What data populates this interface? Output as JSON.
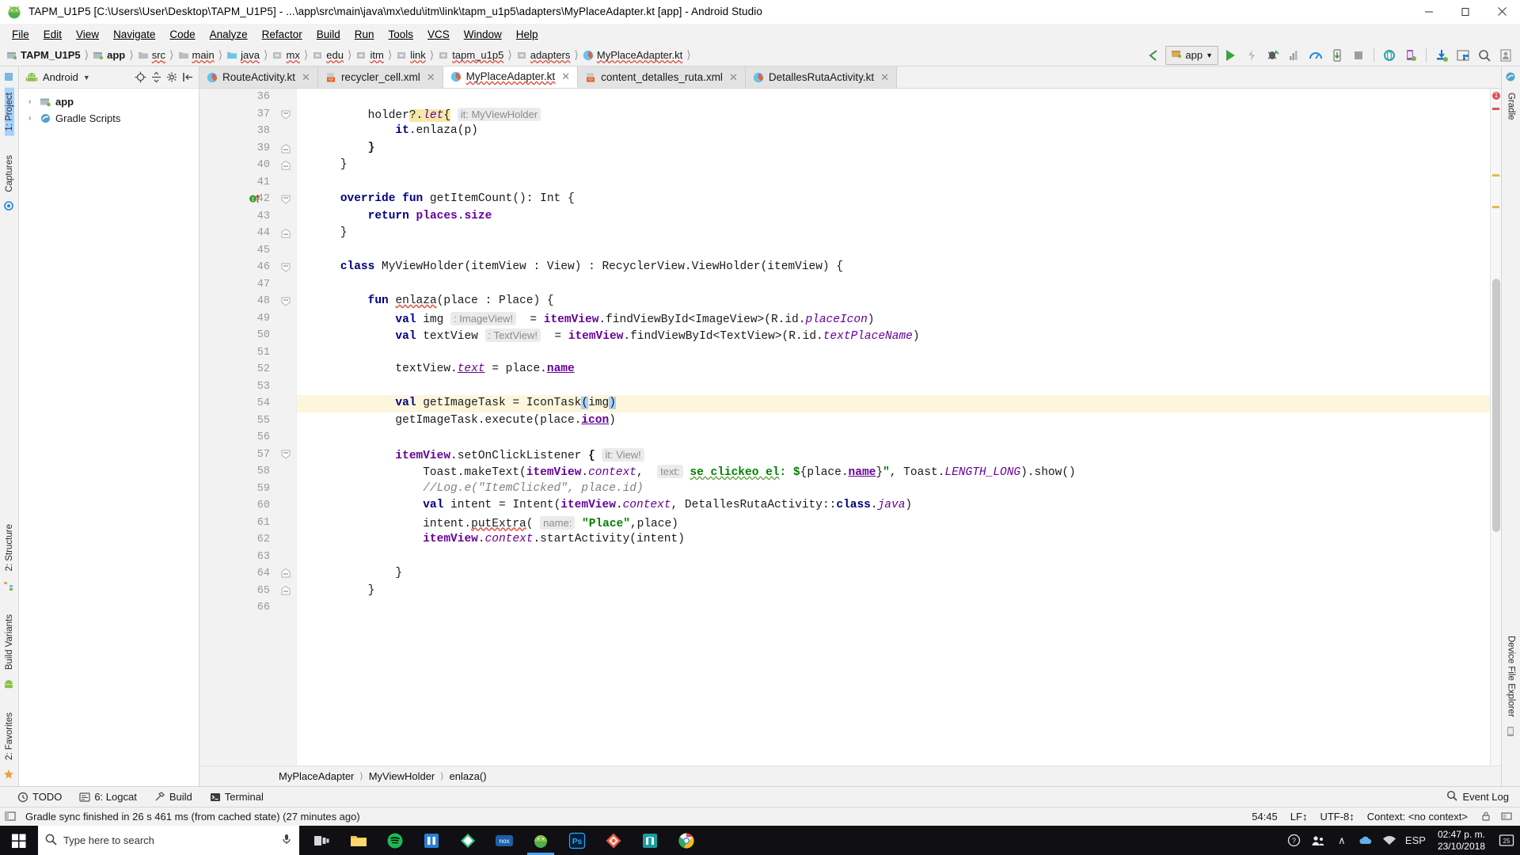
{
  "window": {
    "title": "TAPM_U1P5 [C:\\Users\\User\\Desktop\\TAPM_U1P5] - ...\\app\\src\\main\\java\\mx\\edu\\itm\\link\\tapm_u1p5\\adapters\\MyPlaceAdapter.kt [app] - Android Studio",
    "minimize": "─",
    "maximize": "❐",
    "close": "✕"
  },
  "menu": [
    {
      "label": "File"
    },
    {
      "label": "Edit"
    },
    {
      "label": "View"
    },
    {
      "label": "Navigate"
    },
    {
      "label": "Code"
    },
    {
      "label": "Analyze"
    },
    {
      "label": "Refactor"
    },
    {
      "label": "Build"
    },
    {
      "label": "Run"
    },
    {
      "label": "Tools"
    },
    {
      "label": "VCS"
    },
    {
      "label": "Window"
    },
    {
      "label": "Help"
    }
  ],
  "breadcrumbs": [
    {
      "label": "TAPM_U1P5",
      "icon": "module-icon",
      "bold": true,
      "error": false
    },
    {
      "label": "app",
      "icon": "module-icon",
      "bold": true,
      "error": false
    },
    {
      "label": "src",
      "icon": "folder-icon",
      "bold": false,
      "error": true
    },
    {
      "label": "main",
      "icon": "folder-icon",
      "bold": false,
      "error": true
    },
    {
      "label": "java",
      "icon": "folder-source-icon",
      "bold": false,
      "error": true
    },
    {
      "label": "mx",
      "icon": "package-icon",
      "bold": false,
      "error": true
    },
    {
      "label": "edu",
      "icon": "package-icon",
      "bold": false,
      "error": true
    },
    {
      "label": "itm",
      "icon": "package-icon",
      "bold": false,
      "error": true
    },
    {
      "label": "link",
      "icon": "package-icon",
      "bold": false,
      "error": true
    },
    {
      "label": "tapm_u1p5",
      "icon": "package-icon",
      "bold": false,
      "error": true
    },
    {
      "label": "adapters",
      "icon": "package-icon",
      "bold": false,
      "error": true
    },
    {
      "label": "MyPlaceAdapter.kt",
      "icon": "kotlin-icon",
      "bold": false,
      "error": true
    }
  ],
  "toolbar": {
    "back_arrow": "back-arrow-icon",
    "run_config_label": "app",
    "run_config_caret": "∨",
    "buttons": [
      "run-button",
      "apply-changes-button",
      "debug-button",
      "run-coverage-button",
      "profile-button",
      "attach-debugger-button",
      "stop-button",
      "sync-gradle-button",
      "avd-manager-button",
      "sdk-manager-button",
      "project-structure-button",
      "search-everywhere-button",
      "user-account-button"
    ]
  },
  "leftRail": {
    "items": [
      {
        "label": "1: Project",
        "name": "tool-project"
      },
      {
        "label": "Captures",
        "name": "tool-captures"
      },
      {
        "label": "2: Structure",
        "name": "tool-structure"
      },
      {
        "label": "Build Variants",
        "name": "tool-build-variants"
      },
      {
        "label": "2: Favorites",
        "name": "tool-favorites"
      }
    ]
  },
  "rightRail": {
    "items": [
      {
        "label": "Gradle",
        "name": "tool-gradle"
      },
      {
        "label": "Device File Explorer",
        "name": "tool-device-file-explorer"
      }
    ]
  },
  "project": {
    "header_title": "Android",
    "header_caret": "▾",
    "header_buttons": [
      "locate-icon",
      "collapse-all-icon",
      "settings-icon",
      "hide-icon"
    ],
    "tree": [
      {
        "label": "app",
        "arrow": "›",
        "icon": "module-icon",
        "bold": true
      },
      {
        "label": "Gradle Scripts",
        "arrow": "›",
        "icon": "gradle-icon",
        "bold": false
      }
    ]
  },
  "tabs": [
    {
      "label": "RouteActivity.kt",
      "icon": "kotlin-icon",
      "active": false,
      "error": false
    },
    {
      "label": "recycler_cell.xml",
      "icon": "xml-icon",
      "active": false,
      "error": false
    },
    {
      "label": "MyPlaceAdapter.kt",
      "icon": "kotlin-icon",
      "active": true,
      "error": true
    },
    {
      "label": "content_detalles_ruta.xml",
      "icon": "xml-icon",
      "active": false,
      "error": false
    },
    {
      "label": "DetallesRutaActivity.kt",
      "icon": "kotlin-icon",
      "active": false,
      "error": false
    }
  ],
  "editor": {
    "first_line": 36,
    "last_line": 66,
    "highlight_line": 54,
    "caret_position": "54:45",
    "lines": [
      {
        "n": 36,
        "text": ""
      },
      {
        "n": 37,
        "text": "        holder?.let{ it: MyViewHolder"
      },
      {
        "n": 38,
        "text": "            it.enlaza(p)"
      },
      {
        "n": 39,
        "text": "        }"
      },
      {
        "n": 40,
        "text": "    }"
      },
      {
        "n": 41,
        "text": ""
      },
      {
        "n": 42,
        "text": "    override fun getItemCount(): Int {"
      },
      {
        "n": 43,
        "text": "        return places.size"
      },
      {
        "n": 44,
        "text": "    }"
      },
      {
        "n": 45,
        "text": ""
      },
      {
        "n": 46,
        "text": "    class MyViewHolder(itemView : View) : RecyclerView.ViewHolder(itemView) {"
      },
      {
        "n": 47,
        "text": ""
      },
      {
        "n": 48,
        "text": "        fun enlaza(place : Place) {"
      },
      {
        "n": 49,
        "text": "            val img : ImageView!  = itemView.findViewById<ImageView>(R.id.placeIcon)"
      },
      {
        "n": 50,
        "text": "            val textView : TextView!  = itemView.findViewById<TextView>(R.id.textPlaceName)"
      },
      {
        "n": 51,
        "text": ""
      },
      {
        "n": 52,
        "text": "            textView.text = place.name"
      },
      {
        "n": 53,
        "text": ""
      },
      {
        "n": 54,
        "text": "            val getImageTask = IconTask(img)"
      },
      {
        "n": 55,
        "text": "            getImageTask.execute(place.icon)"
      },
      {
        "n": 56,
        "text": ""
      },
      {
        "n": 57,
        "text": "            itemView.setOnClickListener { it: View!"
      },
      {
        "n": 58,
        "text": "                Toast.makeText(itemView.context,  text: \"se clickeo el: ${place.name}\", Toast.LENGTH_LONG).show()"
      },
      {
        "n": 59,
        "text": "                //Log.e(\"ItemClicked\", place.id)"
      },
      {
        "n": 60,
        "text": "                val intent = Intent(itemView.context, DetallesRutaActivity::class.java)"
      },
      {
        "n": 61,
        "text": "                intent.putExtra( name: \"Place\",place)"
      },
      {
        "n": 62,
        "text": "                itemView.context.startActivity(intent)"
      },
      {
        "n": 63,
        "text": ""
      },
      {
        "n": 64,
        "text": "            }"
      },
      {
        "n": 65,
        "text": "        }"
      },
      {
        "n": 66,
        "text": ""
      }
    ],
    "inlay_hints": [
      "it: MyViewHolder",
      ": ImageView!",
      ": TextView!",
      "it: View!",
      "text:",
      "name:"
    ],
    "gutter_line_42_badge": "implementing-method-marker",
    "error_count_badge": "1"
  },
  "editorBreadcrumb": [
    {
      "label": "MyPlaceAdapter"
    },
    {
      "label": "MyViewHolder"
    },
    {
      "label": "enlaza()"
    }
  ],
  "bottomToolWindows": [
    {
      "label": "TODO",
      "icon": "todo-icon",
      "name": "tool-todo"
    },
    {
      "label": "6: Logcat",
      "icon": "logcat-icon",
      "name": "tool-logcat"
    },
    {
      "label": "Build",
      "icon": "build-icon",
      "name": "tool-build"
    },
    {
      "label": "Terminal",
      "icon": "terminal-icon",
      "name": "tool-terminal"
    }
  ],
  "eventLog": {
    "label": "Event Log",
    "icon": "event-log-icon"
  },
  "statusBar": {
    "message": "Gradle sync finished in 26 s 461 ms (from cached state) (27 minutes ago)",
    "caret": "54:45",
    "line_separator": "LF↕",
    "encoding": "UTF-8↕",
    "context": "Context: <no context>",
    "lock_icon": "lock-icon",
    "memory_icon": "memory-icon"
  },
  "taskbar": {
    "start": "start-button",
    "search_placeholder": "Type here to search",
    "search_icon": "search-icon",
    "mic_icon": "microphone-icon",
    "items": [
      {
        "name": "task-view-icon",
        "label": ""
      },
      {
        "name": "file-explorer-icon",
        "label": ""
      },
      {
        "name": "spotify-icon",
        "label": ""
      },
      {
        "name": "blue-app-icon",
        "label": ""
      },
      {
        "name": "green-app-icon",
        "label": ""
      },
      {
        "name": "nox-icon",
        "label": ""
      },
      {
        "name": "android-studio-icon",
        "label": ""
      },
      {
        "name": "photoshop-icon",
        "label": ""
      },
      {
        "name": "illustrator-icon",
        "label": ""
      },
      {
        "name": "teal-app-icon",
        "label": ""
      },
      {
        "name": "chrome-icon",
        "label": ""
      }
    ],
    "tray": {
      "help_icon": "question-circle-icon",
      "people_icon": "people-icon",
      "chevron_up": "∧",
      "onedrive_icon": "onedrive-icon",
      "network_icon": "network-icon",
      "language": "ESP",
      "time": "02:47 p. m.",
      "date": "23/10/2018",
      "notification_count": "25"
    }
  },
  "colors": {
    "accent_blue": "#2675bf",
    "kotlin_orange": "#e8622c",
    "green_run": "#2eaa41",
    "android_green": "#8bc34a",
    "error_red": "#e24c3f",
    "highlight_yellow": "#fdf6dd",
    "selection_blue": "#a6d2ff"
  }
}
